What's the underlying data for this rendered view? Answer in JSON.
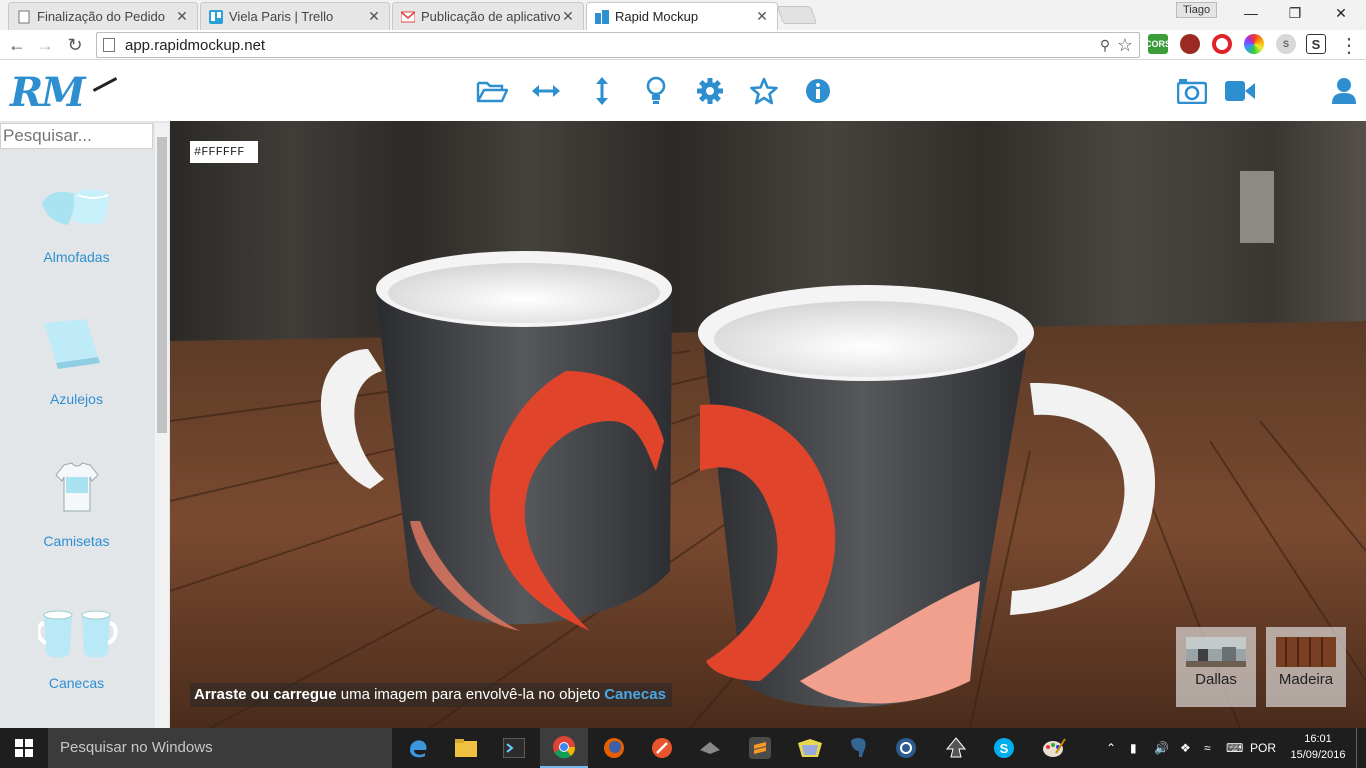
{
  "browser": {
    "tabs": [
      {
        "title": "Finalização do Pedido",
        "active": false
      },
      {
        "title": "Viela Paris | Trello",
        "active": false
      },
      {
        "title": "Publicação de aplicativo W",
        "active": false
      },
      {
        "title": "Rapid Mockup",
        "active": true
      }
    ],
    "profile": "Tiago",
    "url": "app.rapidmockup.net",
    "extensions": [
      "cors",
      "pomodoro",
      "opera",
      "color-wheel",
      "skype-s",
      "s-box"
    ]
  },
  "app": {
    "logo": "RM",
    "toolbar_icons": [
      "folder-open-icon",
      "arrows-horizontal-icon",
      "arrows-vertical-icon",
      "lightbulb-icon",
      "gear-icon",
      "star-icon",
      "info-icon"
    ],
    "right_icons": [
      "camera-icon",
      "video-icon",
      "user-icon"
    ],
    "accent": "#2d8fd0"
  },
  "sidebar": {
    "search_placeholder": "Pesquisar...",
    "categories": [
      {
        "label": "Almofadas",
        "icon": "pillow-icon"
      },
      {
        "label": "Azulejos",
        "icon": "tile-icon"
      },
      {
        "label": "Camisetas",
        "icon": "tshirt-icon"
      },
      {
        "label": "Canecas",
        "icon": "mugs-icon"
      }
    ]
  },
  "stage": {
    "color_hex": "#FFFFFF",
    "hint_bold": "Arraste ou carregue",
    "hint_text": " uma imagem para envolvê-la no objeto ",
    "hint_object": "Canecas",
    "scenes": [
      {
        "label": "Dallas"
      },
      {
        "label": "Madeira"
      }
    ]
  },
  "taskbar": {
    "search_placeholder": "Pesquisar no Windows",
    "language": "POR",
    "time": "16:01",
    "date": "15/09/2016"
  }
}
